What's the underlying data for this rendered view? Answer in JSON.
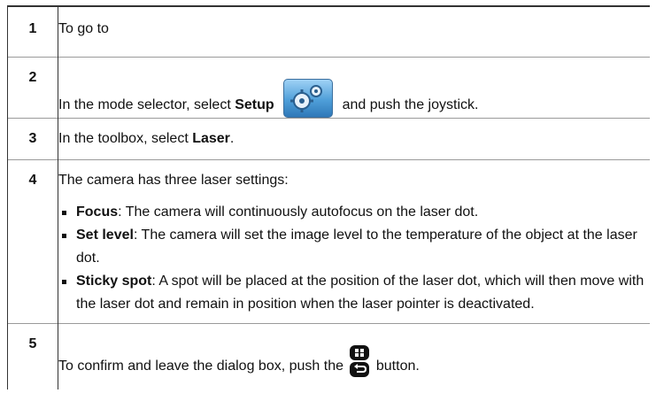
{
  "steps": [
    {
      "num": "1",
      "text": "To go to"
    },
    {
      "num": "2",
      "before": "In the mode selector, select ",
      "bold": "Setup",
      "after": " and push the joystick.",
      "icon": "setup-gear-icon"
    },
    {
      "num": "3",
      "before": "In the toolbox, select ",
      "bold": "Laser",
      "after": "."
    },
    {
      "num": "4",
      "intro": "The camera has three laser settings:",
      "options": [
        {
          "bold": "Focus",
          "text": ": The camera will continuously autofocus on the laser dot."
        },
        {
          "bold": "Set level",
          "text": ": The camera will set the image level to the temperature of the object at the laser dot."
        },
        {
          "bold": "Sticky spot",
          "text": ": A spot will be placed at the position of the laser dot, which will then move with the laser dot and remain in position when the laser pointer is deactivated."
        }
      ]
    },
    {
      "num": "5",
      "before": "To confirm and leave the dialog box, push the ",
      "after": " button.",
      "icon": "joystick-back-button-icon"
    }
  ]
}
